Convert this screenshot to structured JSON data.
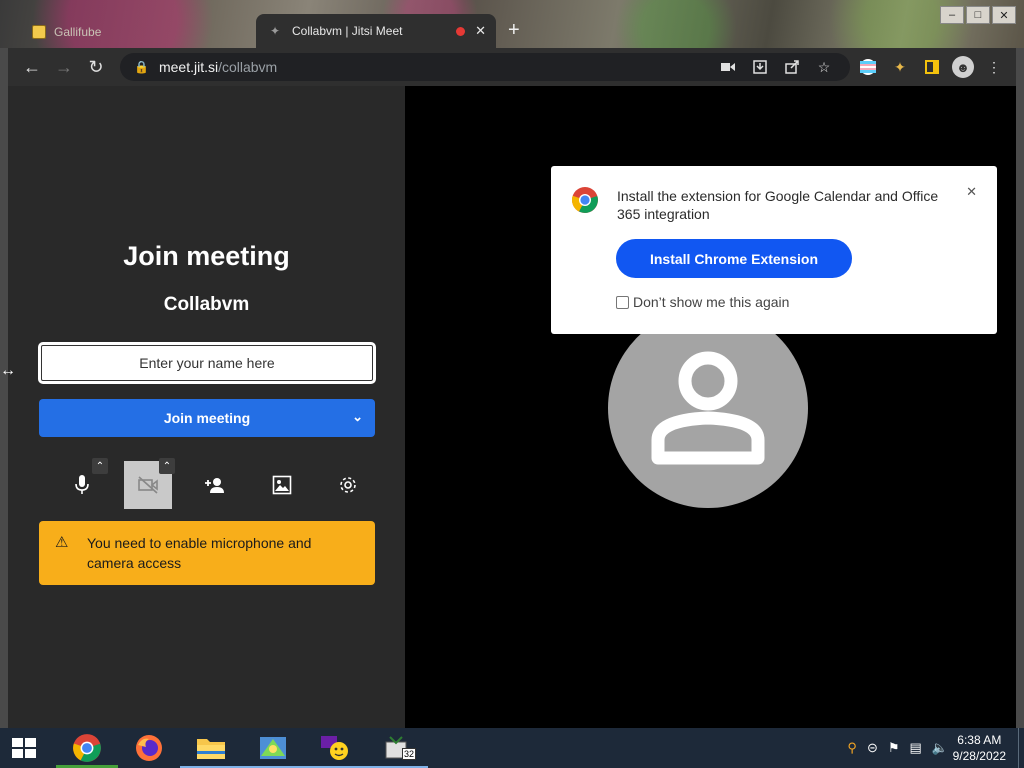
{
  "browser": {
    "inactive_tab_title": "Gallifube",
    "active_tab_title": "Collabvm | Jitsi Meet",
    "new_tab_label": "+",
    "url_host": "meet.jit.si",
    "url_path": "/collabvm"
  },
  "prejoin": {
    "title": "Join meeting",
    "room_name": "Collabvm",
    "name_placeholder": "Enter your name here",
    "join_button_label": "Join meeting",
    "warning_text": "You need to enable microphone and camera access"
  },
  "notification": {
    "message": "Install the extension for Google Calendar and Office 365 integration",
    "install_button_label": "Install Chrome Extension",
    "dont_show_label": "Don’t show me this again"
  },
  "taskbar": {
    "time": "6:38 AM",
    "date": "9/28/2022",
    "badge_count": "32"
  },
  "colors": {
    "join_blue": "#246fe5",
    "warning_yellow": "#f8ae1a",
    "install_blue": "#1157f2",
    "panel_bg": "#292929"
  }
}
